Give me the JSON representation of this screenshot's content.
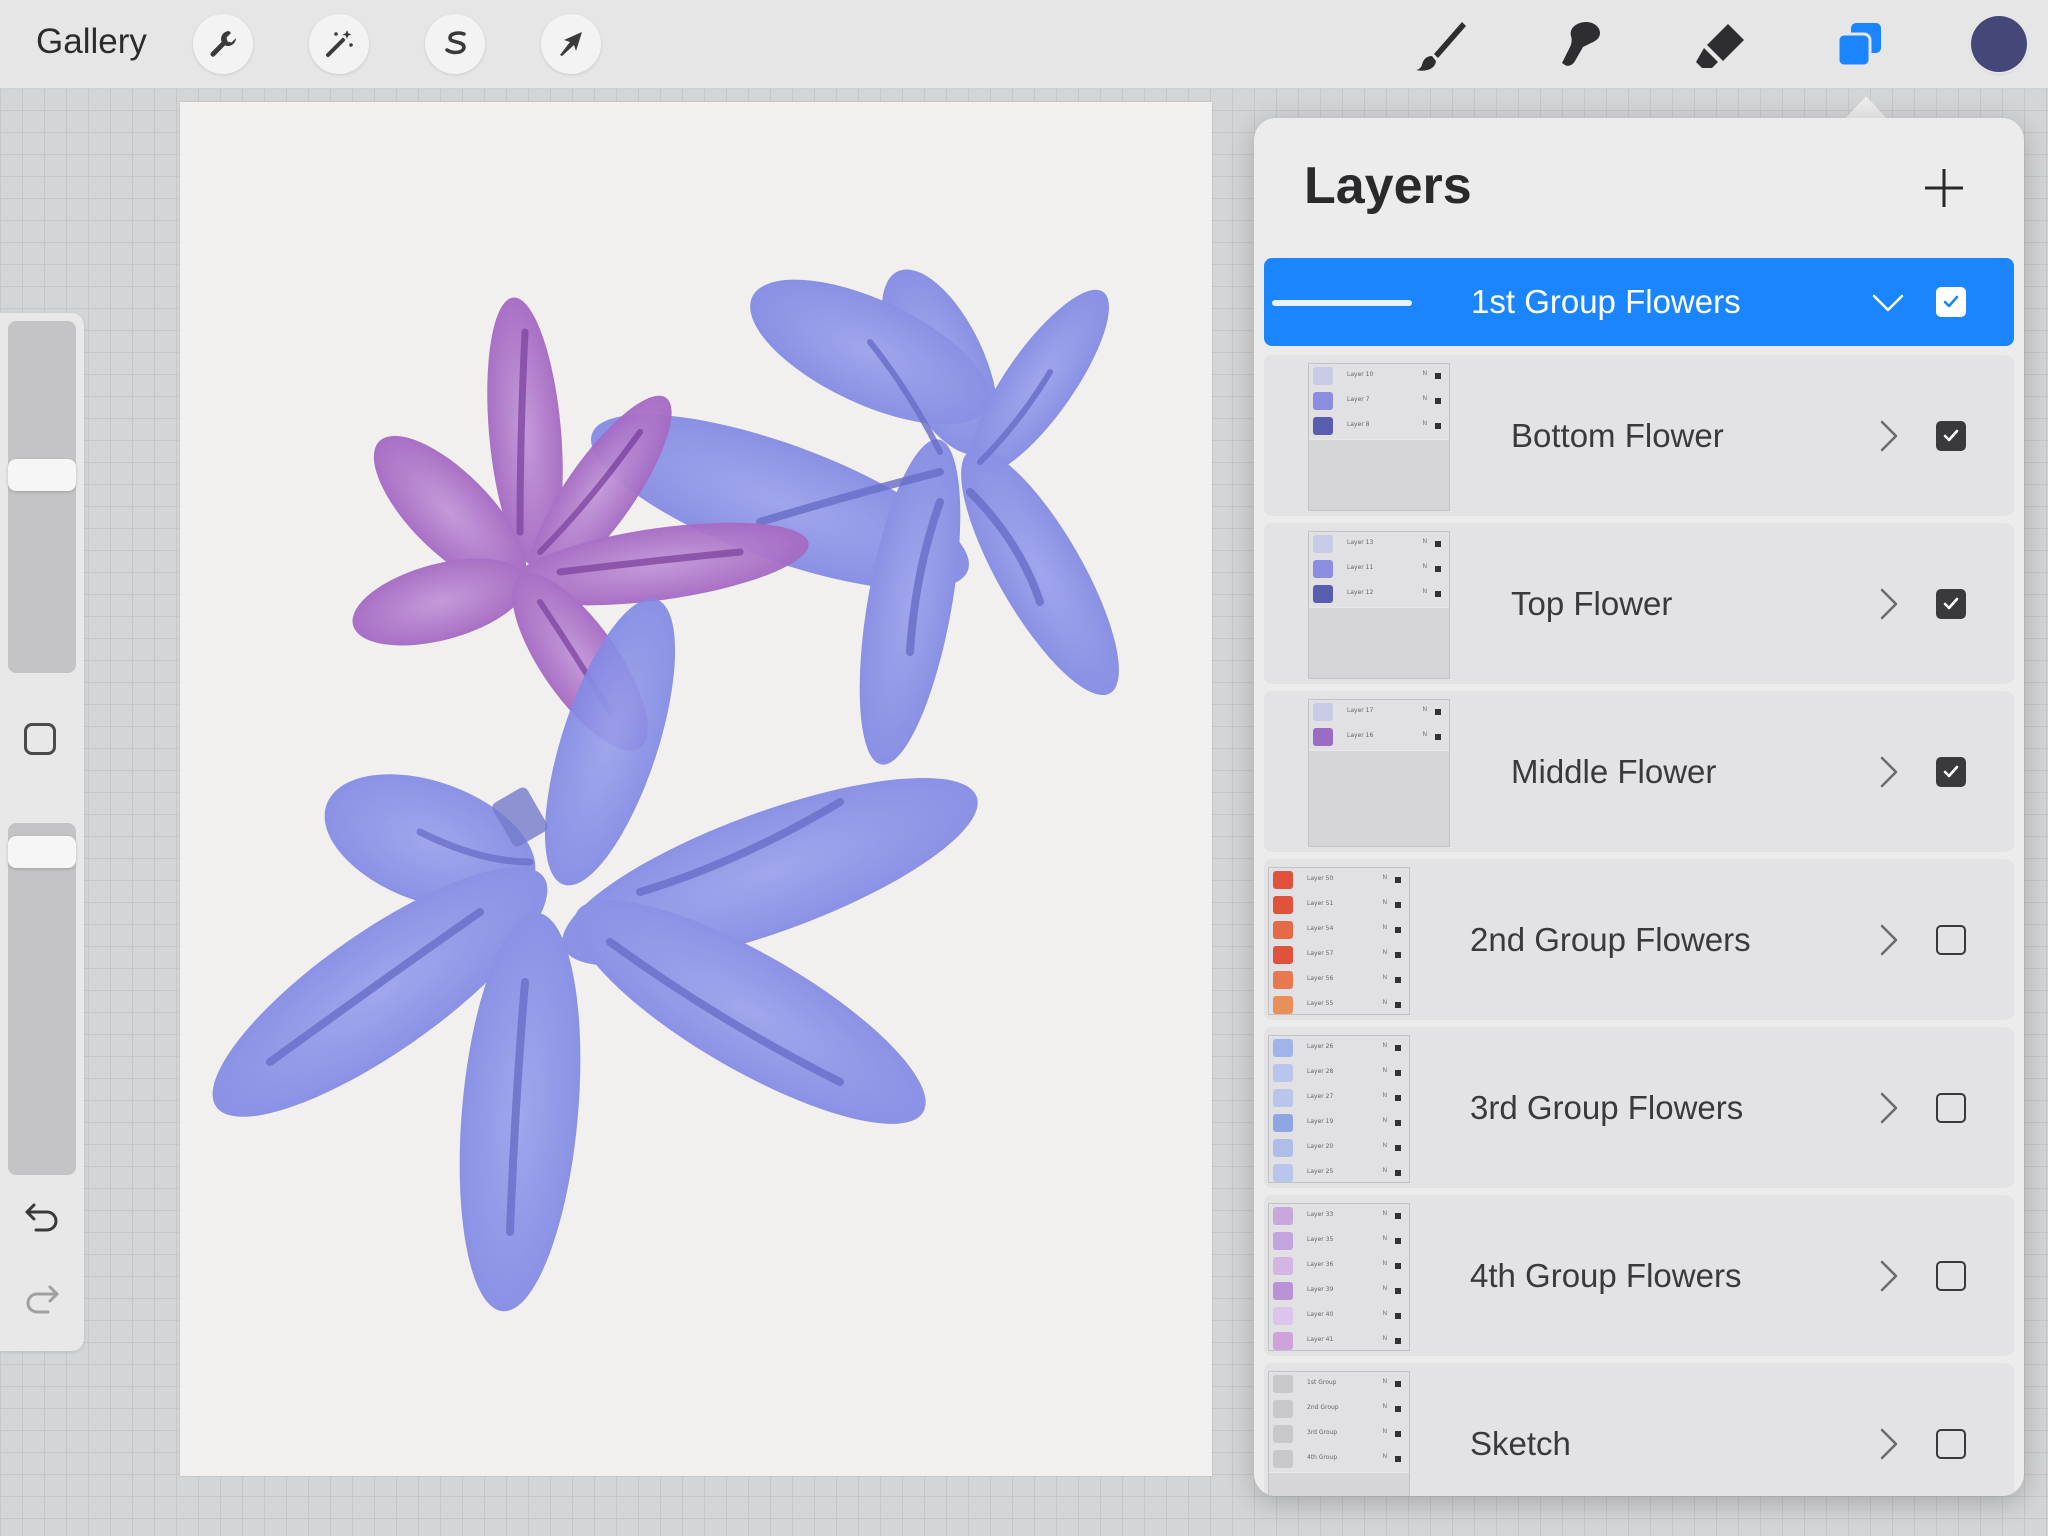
{
  "topbar": {
    "gallery_label": "Gallery",
    "tools": [
      "wrench-icon",
      "magic-wand-icon",
      "selection-s-icon",
      "transform-arrow-icon"
    ],
    "paint_tools": [
      "brush-icon",
      "smudge-icon",
      "eraser-icon",
      "layers-icon"
    ],
    "active_paint_tool": "layers-icon",
    "current_color": "#454779"
  },
  "sidebar": {
    "brush_size_level": 0.57,
    "opacity_level": 0.96,
    "buttons": [
      "modify-square-icon",
      "undo-icon",
      "redo-icon"
    ]
  },
  "panel": {
    "title": "Layers",
    "add_icon": "plus-icon",
    "layers": [
      {
        "name": "1st Group Flowers",
        "visible": true,
        "expanded": true,
        "active": true,
        "kind": "group"
      },
      {
        "name": "Bottom Flower",
        "visible": true,
        "kind": "subgroup",
        "thumb_rows": [
          {
            "label": "Layer 10",
            "color": "#c9cbe6"
          },
          {
            "label": "Layer 7",
            "color": "#8b8ee0"
          },
          {
            "label": "Layer 8",
            "color": "#5a5eb0"
          }
        ]
      },
      {
        "name": "Top Flower",
        "visible": true,
        "kind": "subgroup",
        "thumb_rows": [
          {
            "label": "Layer 13",
            "color": "#c9cbe6"
          },
          {
            "label": "Layer 11",
            "color": "#8b8ee0"
          },
          {
            "label": "Layer 12",
            "color": "#5a5eb0"
          }
        ]
      },
      {
        "name": "Middle Flower",
        "visible": true,
        "kind": "subgroup",
        "thumb_rows": [
          {
            "label": "Layer 17",
            "color": "#c9cbe6"
          },
          {
            "label": "Layer 16",
            "color": "#9a6cc4"
          }
        ]
      },
      {
        "name": "2nd Group Flowers",
        "visible": false,
        "kind": "group",
        "thumb_rows": [
          {
            "label": "Layer 50",
            "color": "#e0523c"
          },
          {
            "label": "Layer 51",
            "color": "#e0523c"
          },
          {
            "label": "Layer 54",
            "color": "#e46a48"
          },
          {
            "label": "Layer 57",
            "color": "#e0523c"
          },
          {
            "label": "Layer 56",
            "color": "#e87850"
          },
          {
            "label": "Layer 55",
            "color": "#e89058"
          }
        ]
      },
      {
        "name": "3rd Group Flowers",
        "visible": false,
        "kind": "group",
        "thumb_rows": [
          {
            "label": "Layer 26",
            "color": "#9fb4e8"
          },
          {
            "label": "Layer 28",
            "color": "#b7c6ea"
          },
          {
            "label": "Layer 27",
            "color": "#b7c6ea"
          },
          {
            "label": "Layer 19",
            "color": "#8ea6e4"
          },
          {
            "label": "Layer 20",
            "color": "#aebee8"
          },
          {
            "label": "Layer 25",
            "color": "#b7c6ea"
          }
        ]
      },
      {
        "name": "4th Group Flowers",
        "visible": false,
        "kind": "group",
        "thumb_rows": [
          {
            "label": "Layer 33",
            "color": "#c8a8dc"
          },
          {
            "label": "Layer 35",
            "color": "#c3a4de"
          },
          {
            "label": "Layer 36",
            "color": "#d4b6e4"
          },
          {
            "label": "Layer 39",
            "color": "#b894d6"
          },
          {
            "label": "Layer 40",
            "color": "#dcc4ea"
          },
          {
            "label": "Layer 41",
            "color": "#cfa2dc"
          }
        ]
      },
      {
        "name": "Sketch",
        "visible": false,
        "kind": "group",
        "thumb_rows": [
          {
            "label": "1st Group",
            "color": "#c8c8ca"
          },
          {
            "label": "2nd Group",
            "color": "#c8c8ca"
          },
          {
            "label": "3rd Group",
            "color": "#c8c8ca"
          },
          {
            "label": "4th Group",
            "color": "#c8c8ca"
          }
        ]
      }
    ]
  },
  "canvas": {
    "background": "#f1f0ee",
    "flower_colors": {
      "blue": "#7f86e4",
      "purple": "#a869c4",
      "vein_blue": "#5c62c4",
      "vein_purple": "#7a3f9e"
    }
  }
}
